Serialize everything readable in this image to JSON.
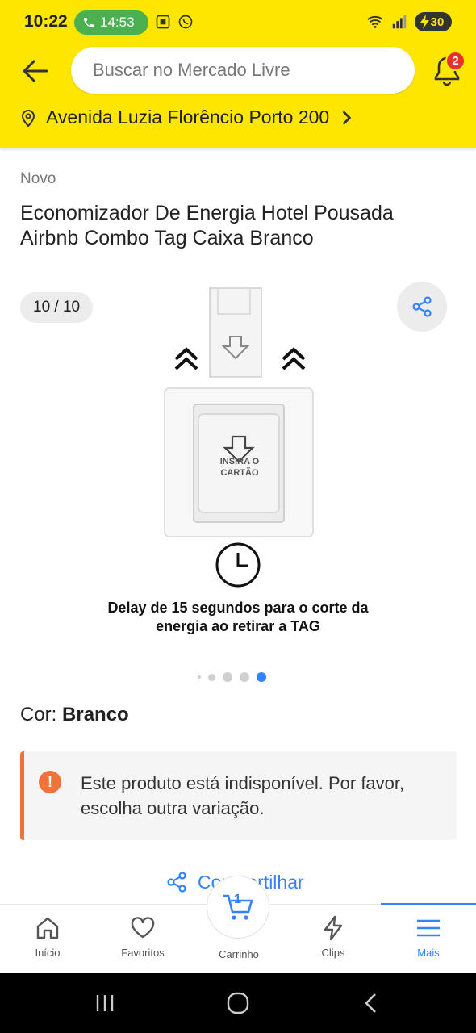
{
  "status_bar": {
    "time": "10:22",
    "call_time": "14:53",
    "battery": "30"
  },
  "header": {
    "search_placeholder": "Buscar no Mercado Livre",
    "notification_count": "2",
    "address": "Avenida Luzia Florêncio Porto 200",
    "bg_color": "#FFE600"
  },
  "product": {
    "condition": "Novo",
    "title": "Economizador De Energia Hotel Pousada Airbnb Combo Tag Caixa Branco",
    "gallery": {
      "counter": "10 / 10",
      "image_label": "INSIRA O CARTÃO",
      "caption": "Delay de 15 segundos para o corte da energia ao retirar a TAG",
      "active_dot_color": "#3483FA"
    },
    "color_label": "Cor:",
    "color_value": "Branco",
    "alert_text": "Este produto está indisponível. Por favor, escolha outra variação.",
    "alert_color": "#F0723C",
    "share_label": "Compartilhar"
  },
  "bottom_nav": {
    "items": [
      {
        "label": "Início",
        "icon": "home-icon"
      },
      {
        "label": "Favoritos",
        "icon": "heart-icon"
      },
      {
        "label": "Carrinho",
        "icon": "cart-icon",
        "count": "1"
      },
      {
        "label": "Clips",
        "icon": "bolt-icon"
      },
      {
        "label": "Mais",
        "icon": "menu-icon"
      }
    ],
    "active": "Mais",
    "accent": "#3483FA"
  }
}
